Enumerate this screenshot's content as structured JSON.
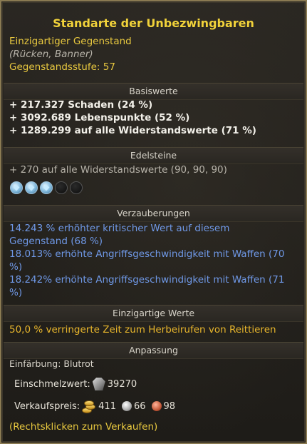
{
  "item": {
    "title": "Standarte der Unbezwingbaren",
    "rarity": "Einzigartiger Gegenstand",
    "slot": "(Rücken, Banner)",
    "level_line": "Gegenstandsstufe: 57"
  },
  "sections": {
    "base": "Basiswerte",
    "gems": "Edelsteine",
    "enchant": "Verzauberungen",
    "unique": "Einzigartige Werte",
    "custom": "Anpassung"
  },
  "base_stats": [
    "+ 217.327 Schaden (24 %)",
    "+ 3092.689 Lebenspunkte (52 %)",
    "+ 1289.299 auf alle Widerstandswerte (71 %)"
  ],
  "gem_stat": "+ 270 auf alle Widerstandswerte (90, 90, 90)",
  "sockets": {
    "filled": 3,
    "total": 5
  },
  "enchantments": [
    "14.243 % erhöhter kritischer Wert auf diesem",
    "Gegenstand (68 %)",
    "18.013% erhöhte Angriffsgeschwindigkeit mit Waffen (70",
    "%)",
    "18.242% erhöhte Angriffsgeschwindigkeit mit Waffen (71",
    "%)"
  ],
  "unique_stat": "50,0 % verringerte Zeit zum Herbeirufen von Reittieren",
  "dye": "Einfärbung: Blutrot",
  "disenchant": {
    "label": "Einschmelzwert:",
    "value": "39270"
  },
  "sell": {
    "label": "Verkaufspreis:",
    "gold": "411",
    "silver": "66",
    "copper": "98"
  },
  "hint": "(Rechtsklicken zum Verkaufen)",
  "colors": {
    "title": "#f1d23a",
    "enchant": "#6f98e6",
    "unique": "#e8b62c"
  }
}
